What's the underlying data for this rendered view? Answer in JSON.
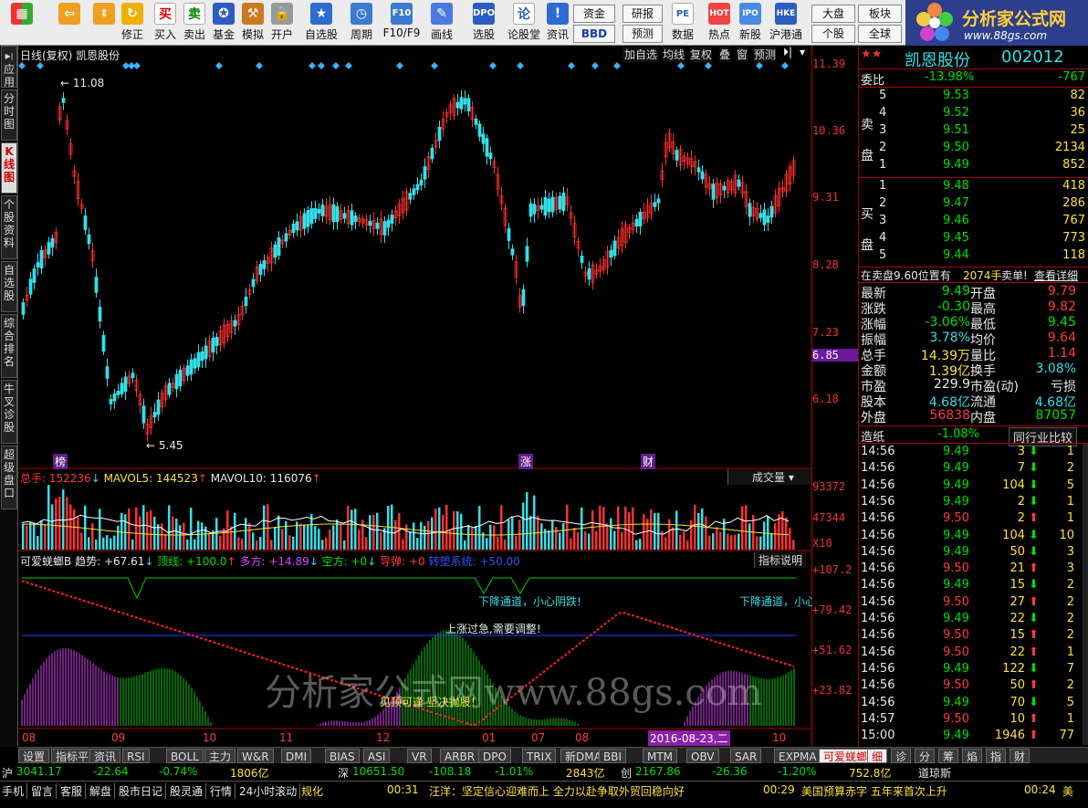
{
  "toolbar": {
    "buttons": [
      {
        "label": "",
        "icon": "windows-icon"
      },
      {
        "label": "",
        "icon": "back-arrow-icon"
      },
      {
        "label": "",
        "icon": "up-down-arrow-icon"
      },
      {
        "label": "修正",
        "icon": "refresh-icon"
      },
      {
        "label": "买入",
        "icon": "buy-icon"
      },
      {
        "label": "卖出",
        "icon": "sell-icon"
      },
      {
        "label": "基金",
        "icon": "fund-icon"
      },
      {
        "label": "模拟",
        "icon": "gavel-icon"
      },
      {
        "label": "开户",
        "icon": "lock-icon"
      },
      {
        "label": "自选股",
        "icon": "star-icon"
      },
      {
        "label": "周期",
        "icon": "clock-icon"
      },
      {
        "label": "F10/F9",
        "icon": "f10-icon"
      },
      {
        "label": "画线",
        "icon": "pencil-icon"
      },
      {
        "label": "选股",
        "icon": "dpo-icon"
      },
      {
        "label": "论股堂",
        "icon": "forum-icon"
      },
      {
        "label": "资讯",
        "icon": "info-icon"
      }
    ],
    "small_buttons": [
      "资金",
      "BBD",
      "研报",
      "预测",
      "数据",
      "热点",
      "新股",
      "沪港通",
      "大盘",
      "个股",
      "板块",
      "全球"
    ],
    "small_icons": [
      "PE",
      "HOT",
      "IPO",
      "HKE"
    ]
  },
  "logo": {
    "title": "分析家公式网",
    "url": "www.88gs.com"
  },
  "left_tabs": [
    "应用",
    "分时图",
    "K线图",
    "个股资料",
    "自选股",
    "综合排名",
    "牛叉诊股",
    "超级盘口"
  ],
  "chart": {
    "title": "日线(复权) 凯恩股份",
    "header_buttons": [
      "加自选",
      "均线",
      "复权",
      "叠",
      "窗",
      "预测"
    ],
    "high_label": "11.08",
    "low_label": "5.45",
    "markers": [
      "榜",
      "涨",
      "财"
    ],
    "price_axis": [
      "11.39",
      "10.36",
      "9.31",
      "8.28",
      "7.23",
      "6.85",
      "6.18"
    ],
    "volume_header": {
      "total_label": "总手:",
      "total": "152236",
      "ma5_label": "MAVOL5:",
      "ma5": "144523",
      "ma10_label": "MAVOL10:",
      "ma10": "116076"
    },
    "volume_button": "成交量",
    "volume_axis": [
      "93372",
      "47344",
      "X10"
    ],
    "indicator_header": {
      "name": "可爱蜣螂B",
      "trend_label": "趋势:",
      "trend": "+67.61",
      "top_label": "顶线:",
      "top": "+100.0",
      "long_label": "多方:",
      "long": "+14.89",
      "short_label": "空方:",
      "short": "+0",
      "guide_label": "导弹:",
      "guide": "+0",
      "sys_label": "转塑系统:",
      "sys": "+50.00"
    },
    "indicator_button": "指标说明",
    "indicator_axis": [
      "+107.2",
      "+79.42",
      "+51.62",
      "+23.82"
    ],
    "annotations": [
      "下降通道，小心阴跌!",
      "下降通道，小心",
      "上涨过急,需要调整!",
      "见顶可逢 坚决抛股!"
    ],
    "watermark": "分析家公式网www.88gs.com",
    "x_axis": [
      "08",
      "09",
      "10",
      "11",
      "12",
      "01",
      "07",
      "08",
      "2016-08-23,二",
      "10"
    ]
  },
  "quote": {
    "name": "凯恩股份",
    "code": "002012",
    "weibi_label": "委比",
    "weibi": "-13.98%",
    "weicha": "-767",
    "sell_label": "卖盘",
    "buy_label": "买盘",
    "asks": [
      {
        "lv": "5",
        "p": "9.53",
        "v": "82"
      },
      {
        "lv": "4",
        "p": "9.52",
        "v": "36"
      },
      {
        "lv": "3",
        "p": "9.51",
        "v": "25"
      },
      {
        "lv": "2",
        "p": "9.50",
        "v": "2134"
      },
      {
        "lv": "1",
        "p": "9.49",
        "v": "852"
      }
    ],
    "bids": [
      {
        "lv": "1",
        "p": "9.48",
        "v": "418"
      },
      {
        "lv": "2",
        "p": "9.47",
        "v": "286"
      },
      {
        "lv": "3",
        "p": "9.46",
        "v": "767"
      },
      {
        "lv": "4",
        "p": "9.45",
        "v": "773"
      },
      {
        "lv": "5",
        "p": "9.44",
        "v": "118"
      }
    ],
    "notice": "在卖盘9.60位置有",
    "notice_vol": "2074手",
    "notice_tail": "卖单!",
    "notice_link": "查看详细",
    "stats": [
      [
        "最新",
        "9.49",
        "开盘",
        "9.79"
      ],
      [
        "涨跌",
        "-0.30",
        "最高",
        "9.82"
      ],
      [
        "涨幅",
        "-3.06%",
        "最低",
        "9.45"
      ],
      [
        "振幅",
        "3.78%",
        "均价",
        "9.64"
      ],
      [
        "总手",
        "14.39万",
        "量比",
        "1.14"
      ],
      [
        "金额",
        "1.39亿",
        "换手",
        "3.08%"
      ],
      [
        "市盈",
        "229.9",
        "市盈(动)",
        "亏损"
      ],
      [
        "股本",
        "4.68亿",
        "流通",
        "4.68亿"
      ],
      [
        "外盘",
        "56838",
        "内盘",
        "87057"
      ]
    ],
    "industry_label": "造纸",
    "industry_chg": "-1.08%",
    "compare_btn": "同行业比较",
    "ticks": [
      [
        "14:56",
        "9.49",
        "3",
        "dn",
        "1"
      ],
      [
        "14:56",
        "9.49",
        "7",
        "dn",
        "2"
      ],
      [
        "14:56",
        "9.49",
        "104",
        "dn",
        "5"
      ],
      [
        "14:56",
        "9.49",
        "2",
        "dn",
        "1"
      ],
      [
        "14:56",
        "9.50",
        "2",
        "up",
        "1"
      ],
      [
        "14:56",
        "9.49",
        "104",
        "dn",
        "10"
      ],
      [
        "14:56",
        "9.49",
        "50",
        "dn",
        "3"
      ],
      [
        "14:56",
        "9.50",
        "21",
        "up",
        "3"
      ],
      [
        "14:56",
        "9.49",
        "15",
        "dn",
        "2"
      ],
      [
        "14:56",
        "9.50",
        "27",
        "up",
        "2"
      ],
      [
        "14:56",
        "9.49",
        "22",
        "dn",
        "2"
      ],
      [
        "14:56",
        "9.50",
        "15",
        "up",
        "2"
      ],
      [
        "14:56",
        "9.50",
        "22",
        "up",
        "1"
      ],
      [
        "14:56",
        "9.49",
        "122",
        "dn",
        "7"
      ],
      [
        "14:56",
        "9.50",
        "50",
        "up",
        "2"
      ],
      [
        "14:56",
        "9.49",
        "70",
        "dn",
        "5"
      ],
      [
        "14:57",
        "9.50",
        "10",
        "up",
        "1"
      ],
      [
        "15:00",
        "9.49",
        "1946",
        "up",
        "77"
      ]
    ]
  },
  "bottom_tabs": [
    "设置",
    "指标平台",
    "资讯",
    "RSI",
    "BOLL",
    "主力",
    "W&R",
    "DMI",
    "BIAS",
    "ASI",
    "VR",
    "ARBR",
    "DPO",
    "TRIX",
    "新DMA",
    "BBI",
    "MTM",
    "OBV",
    "SAR",
    "EXPMA",
    "可爱蜣螂B"
  ],
  "right_tabs": [
    "细",
    "诊",
    "分",
    "筹",
    "焰",
    "指",
    "财"
  ],
  "ticker": [
    {
      "k": "沪",
      "v": "3041.17",
      "c": "-22.64",
      "p": "-0.74%",
      "a": "1806亿"
    },
    {
      "k": "深",
      "v": "10651.50",
      "c": "-108.18",
      "p": "-1.01%",
      "a": "2843亿"
    },
    {
      "k": "创",
      "v": "2167.86",
      "c": "-26.36",
      "p": "-1.20%",
      "a": "752.8亿"
    },
    {
      "k": "道琼斯",
      "v": "",
      "c": "",
      "p": "",
      "a": ""
    }
  ],
  "status": {
    "items": [
      "手机",
      "留言",
      "客服",
      "解盘",
      "股市日记",
      "股灵通",
      "行情",
      "24小时滚动"
    ],
    "news1_time": "00:31",
    "news1": "汪洋：坚定信心迎难而上 全力以赴争取外贸回稳向好",
    "news2_time": "00:29",
    "news2": "美国预算赤字 五年来首次上升",
    "news3_time": "00:24",
    "news3": "美",
    "label": "规化"
  },
  "colors": {
    "up": "#ff3b3b",
    "down": "#00e000",
    "cyan": "#33dfe8",
    "accent": "#a00000"
  }
}
